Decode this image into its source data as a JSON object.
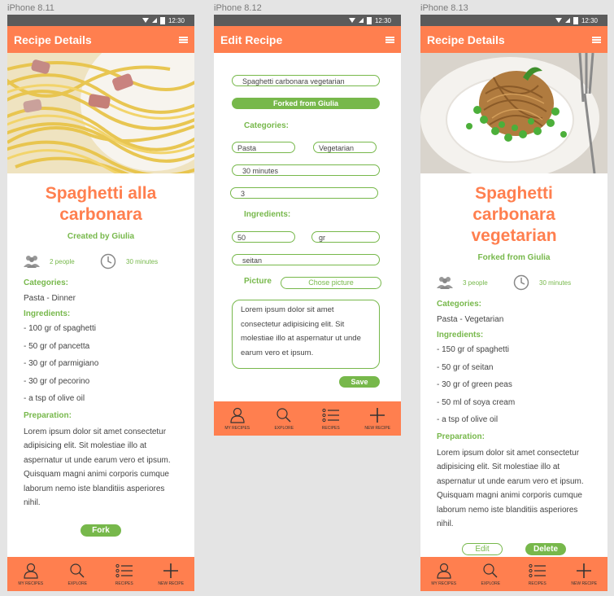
{
  "artboards": [
    "iPhone 8.11",
    "iPhone 8.12",
    "iPhone 8.13"
  ],
  "status_time": "12:30",
  "nav": [
    "MY RECIPES",
    "EXPLORE",
    "RECIPES",
    "NEW RECIPE"
  ],
  "screen1": {
    "appbar_title": "Recipe Details",
    "recipe_title": "Spaghetti alla carbonara",
    "created_by": "Created by Giulia",
    "people": "2 people",
    "time": "30 minutes",
    "categories_label": "Categories:",
    "categories": "Pasta - Dinner",
    "ingredients_label": "Ingredients:",
    "ingredients": [
      "- 100 gr of spaghetti",
      "- 50 gr of pancetta",
      "- 30 gr of parmigiano",
      "- 30 gr of pecorino",
      "- a tsp of olive oil"
    ],
    "preparation_label": "Preparation:",
    "preparation": "Lorem ipsum dolor sit amet consectetur adipisicing elit. Sit molestiae illo at aspernatur ut unde earum vero et ipsum. Quisquam magni animi corporis cumque laborum nemo iste blanditiis asperiores nihil.",
    "fork_button": "Fork"
  },
  "screen2": {
    "appbar_title": "Edit Recipe",
    "name_value": "Spaghetti carbonara vegetarian",
    "forked_from": "Forked from Giulia",
    "categories_label": "Categories:",
    "category1": "Pasta",
    "category2": "Vegetarian",
    "time_value": "30 minutes",
    "people_value": "3",
    "ingredients_label": "Ingredients:",
    "quantity_value": "50",
    "unit_value": "gr",
    "ingredient_value": "seitan",
    "picture_label": "Picture",
    "choose_picture": "Chose picture",
    "description": "Lorem ipsum dolor sit amet consectetur adipisicing elit. Sit molestiae illo at aspernatur ut unde earum vero et ipsum.",
    "save_button": "Save"
  },
  "screen3": {
    "appbar_title": "Recipe Details",
    "recipe_title": "Spaghetti carbonara vegetarian",
    "created_by": "Forked from Giulia",
    "people": "3 people",
    "time": "30 minutes",
    "categories_label": "Categories:",
    "categories": "Pasta - Vegetarian",
    "ingredients_label": "Ingredients:",
    "ingredients": [
      "- 150 gr of spaghetti",
      "- 50 gr of seitan",
      "- 30 gr of green peas",
      "- 50 ml of soya cream",
      "- a tsp of olive oil"
    ],
    "preparation_label": "Preparation:",
    "preparation": "Lorem ipsum dolor sit amet consectetur adipisicing elit. Sit molestiae illo at aspernatur ut unde earum vero et ipsum. Quisquam magni animi corporis cumque laborum nemo iste blanditiis asperiores nihil.",
    "edit_button": "Edit",
    "delete_button": "Delete"
  },
  "colors": {
    "primary": "#ff7f4f",
    "accent": "#77b84b",
    "status_bar": "#5b5b5b"
  }
}
